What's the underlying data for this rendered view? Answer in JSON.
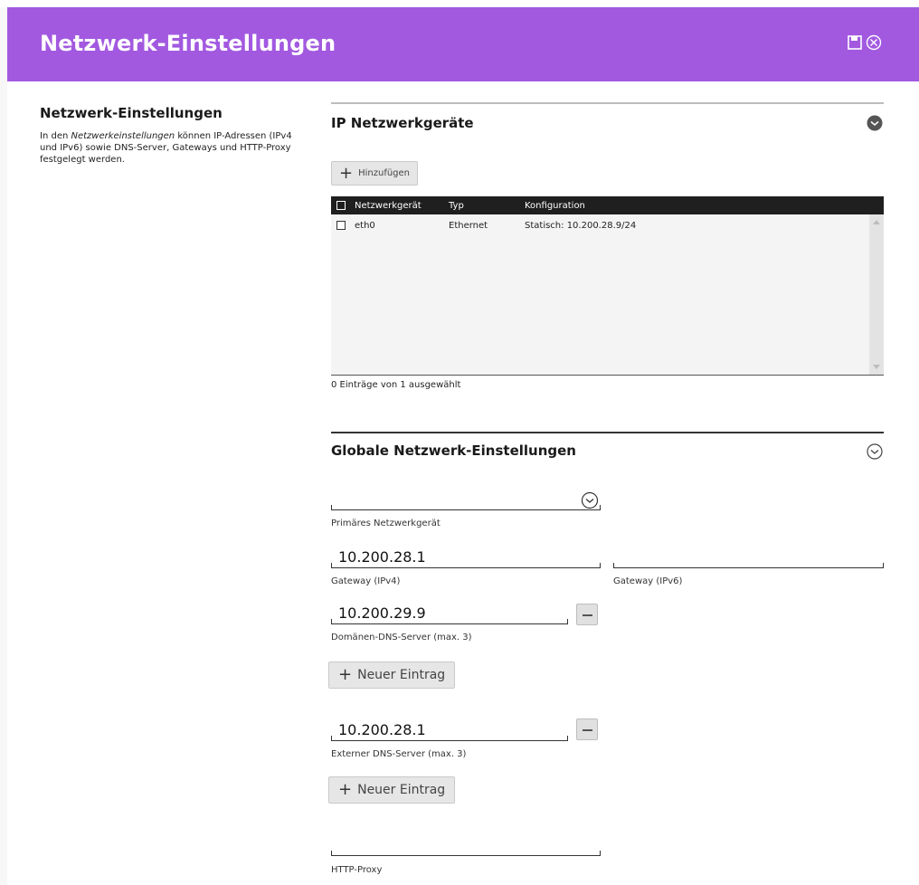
{
  "window": {
    "title": "Netzwerk-Einstellungen",
    "save_icon": "save-icon",
    "close_icon": "close-circle-icon"
  },
  "sidebar": {
    "heading": "Netzwerk-Einstellungen",
    "description_prefix": "In den ",
    "description_italic": "Netzwerkeinstellungen",
    "description_suffix": " können IP-Adressen (IPv4 und IPv6) sowie DNS-Server, Gateways und HTTP-Proxy festgelegt werden."
  },
  "ip_section": {
    "title": "IP Netzwerkgeräte",
    "add_button": "Hinzufügen",
    "columns": [
      "Netzwerkgerät",
      "Typ",
      "Konfiguration"
    ],
    "rows": [
      {
        "device": "eth0",
        "type": "Ethernet",
        "config": "Statisch: 10.200.28.9/24"
      }
    ],
    "summary": "0 Einträge von 1 ausgewählt"
  },
  "global_section": {
    "title": "Globale Netzwerk-Einstellungen",
    "primary_device": {
      "value": "",
      "label": "Primäres Netzwerkgerät"
    },
    "gateway_ipv4": {
      "value": "10.200.28.1",
      "label": "Gateway (IPv4)"
    },
    "gateway_ipv6": {
      "value": "",
      "label": "Gateway (IPv6)"
    },
    "domain_dns": {
      "value": "10.200.29.9",
      "label": "Domänen-DNS-Server (max. 3)"
    },
    "new_entry_label": "Neuer Eintrag",
    "external_dns": {
      "value": "10.200.28.1",
      "label": "Externer DNS-Server (max. 3)"
    },
    "http_proxy": {
      "value": "",
      "label": "HTTP-Proxy"
    }
  },
  "colors": {
    "header": "#a259e0",
    "table_header": "#1f1f1f"
  }
}
